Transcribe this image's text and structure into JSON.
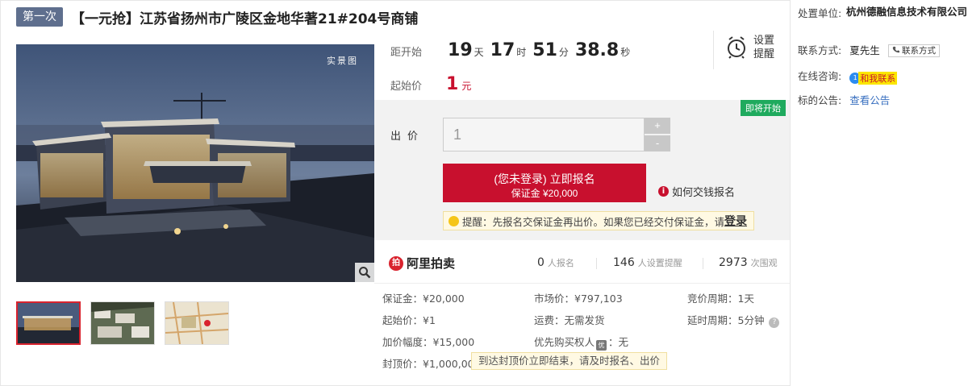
{
  "header": {
    "round_badge": "第一次",
    "title": "【一元抢】江苏省扬州市广陵区金地华著21#204号商铺"
  },
  "gallery": {
    "watermark": "实景图",
    "thumbnails": [
      "thumb-1",
      "thumb-2",
      "thumb-3"
    ]
  },
  "countdown": {
    "label": "距开始",
    "days": "19",
    "days_unit": "天",
    "hours": "17",
    "hours_unit": "时",
    "minutes": "51",
    "minutes_unit": "分",
    "seconds": "38.8",
    "seconds_unit": "秒"
  },
  "reminder": {
    "label": "设置提醒"
  },
  "start_price": {
    "label": "起始价",
    "value": "1",
    "unit": "元"
  },
  "bid": {
    "status_tag": "即将开始",
    "label": "出价",
    "input_value": "1",
    "increment": "+",
    "decrement": "-",
    "apply_line1": "(您未登录) 立即报名",
    "apply_line2": "保证金 ¥20,000",
    "how_to_pay": "如何交钱报名",
    "tip_text": "提醒：先报名交保证金再出价。如果您已经交付保证金，请",
    "tip_login": "登录"
  },
  "platform": {
    "logo_text": "阿里拍卖"
  },
  "stats": {
    "signups_value": "0",
    "signups_label": "人报名",
    "reminders_value": "146",
    "reminders_label": "人设置提醒",
    "views_value": "2973",
    "views_label": "次围观"
  },
  "details": {
    "deposit": "保证金：¥20,000",
    "market_price": "市场价：¥797,103",
    "bid_period": "竞价周期：1天",
    "start_price": "起始价：¥1",
    "shipping": "运费：无需发货",
    "delay_period": "延时周期：5分钟",
    "increment": "加价幅度：¥15,000",
    "priority_buyer_prefix": "优先购买权人",
    "priority_icon": "优",
    "priority_buyer_value": "：无",
    "cap_price": "封顶价：¥1,000,000",
    "cap_note": "到达封顶价立即结束，请及时报名、出价"
  },
  "sidebar": {
    "disposer_label": "处置单位:",
    "disposer_value": "杭州德融信息技术有限公司",
    "contact_label": "联系方式:",
    "contact_name": "夏先生",
    "contact_button": "联系方式",
    "chat_label": "在线咨询:",
    "chat_icon": "1",
    "chat_button": "和我联系",
    "notice_label": "标的公告:",
    "notice_link": "查看公告"
  },
  "colors": {
    "accent_red": "#c8102e",
    "badge_blue": "#5f6f8e",
    "status_green": "#1faa5e",
    "link_blue": "#3a70c0"
  }
}
